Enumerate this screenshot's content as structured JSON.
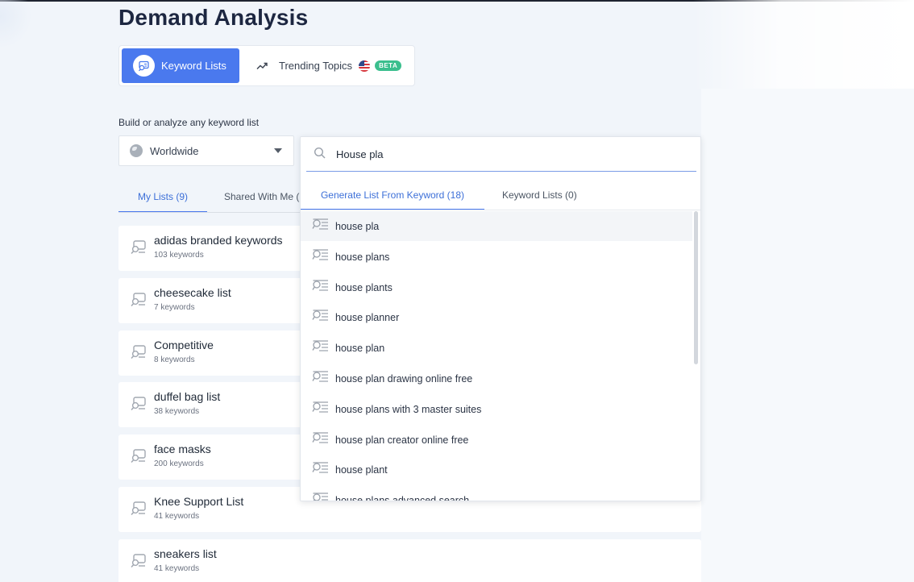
{
  "header": {
    "title": "Demand Analysis"
  },
  "mode_tabs": {
    "keyword_lists": "Keyword Lists",
    "trending_topics": "Trending Topics",
    "beta_badge": "BETA"
  },
  "builder": {
    "label": "Build or analyze any keyword list",
    "region": "Worldwide",
    "search_value": "House pla"
  },
  "list_tabs": {
    "my_lists": "My Lists (9)",
    "shared": "Shared With Me ("
  },
  "lists": [
    {
      "name": "adidas branded keywords",
      "count": "103 keywords"
    },
    {
      "name": "cheesecake list",
      "count": "7 keywords"
    },
    {
      "name": "Competitive",
      "count": "8 keywords"
    },
    {
      "name": "duffel bag list",
      "count": "38 keywords"
    },
    {
      "name": "face masks",
      "count": "200 keywords"
    },
    {
      "name": "Knee Support List",
      "count": "41 keywords"
    },
    {
      "name": "sneakers list",
      "count": "41 keywords"
    }
  ],
  "dropdown": {
    "tab_generate": "Generate List From Keyword (18)",
    "tab_lists": "Keyword Lists (0)",
    "suggestions": [
      "house pla",
      "house plans",
      "house plants",
      "house planner",
      "house plan",
      "house plan drawing online free",
      "house plans with 3 master suites",
      "house plan creator online free",
      "house plant",
      "house plans advanced search"
    ]
  },
  "colors": {
    "accent": "#4a79ee",
    "title": "#1d2741",
    "beta": "#3bbf8e",
    "background": "#f1f5fa"
  },
  "icons": {
    "keyword_lists_tab": "keyword-list-icon",
    "trending": "trending-up-icon",
    "flag": "us-flag-icon",
    "region": "globe-icon",
    "search": "search-icon",
    "list_item": "keyword-list-icon",
    "suggestion": "search-list-icon"
  }
}
